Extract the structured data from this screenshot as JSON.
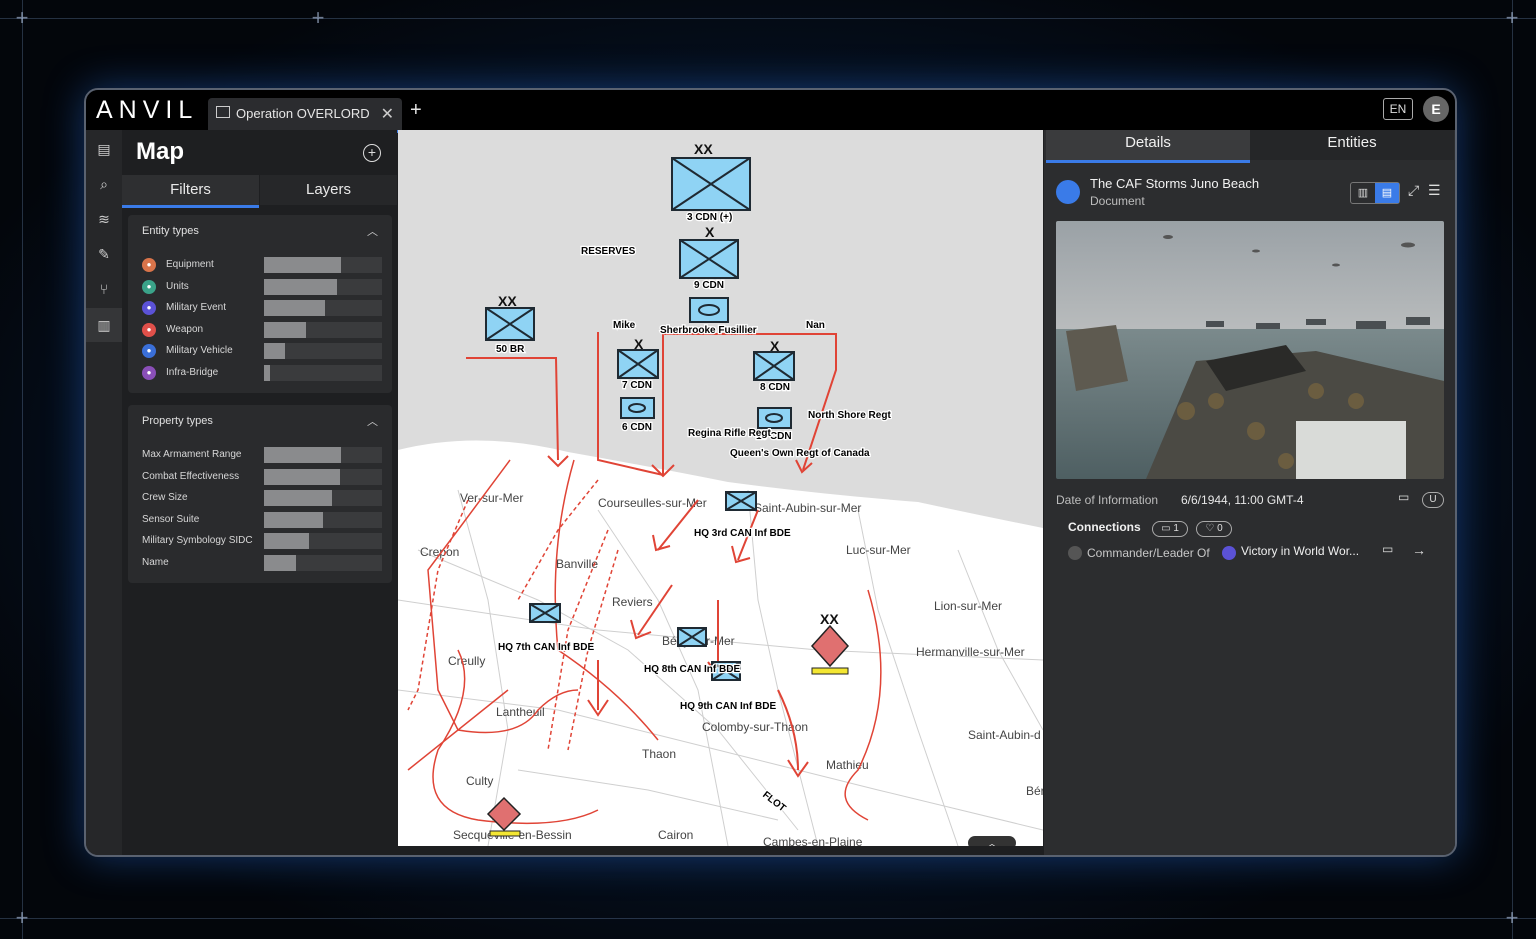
{
  "app": {
    "logo": "ANVIL",
    "tab_label": "Operation OVERLORD",
    "new_tab": "+",
    "language": "EN",
    "avatar_initial": "E"
  },
  "left_panel": {
    "title": "Map",
    "tabs": [
      {
        "label": "Filters",
        "active": true
      },
      {
        "label": "Layers",
        "active": false
      }
    ],
    "entity_types": {
      "title": "Entity types",
      "items": [
        {
          "label": "Equipment",
          "color": "#d9744a",
          "fill": 0.65
        },
        {
          "label": "Units",
          "color": "#3aa389",
          "fill": 0.62
        },
        {
          "label": "Military Event",
          "color": "#5b52d6",
          "fill": 0.52
        },
        {
          "label": "Weapon",
          "color": "#e0504a",
          "fill": 0.36
        },
        {
          "label": "Military Vehicle",
          "color": "#3a6fd8",
          "fill": 0.18
        },
        {
          "label": "Infra-Bridge",
          "color": "#8a4fb8",
          "fill": 0.05
        }
      ]
    },
    "property_types": {
      "title": "Property types",
      "items": [
        {
          "label": "Max Armament Range",
          "fill": 0.65
        },
        {
          "label": "Combat Effectiveness",
          "fill": 0.64
        },
        {
          "label": "Crew Size",
          "fill": 0.58
        },
        {
          "label": "Sensor Suite",
          "fill": 0.5
        },
        {
          "label": "Military Symbology SIDC",
          "fill": 0.38
        },
        {
          "label": "Name",
          "fill": 0.27
        }
      ]
    }
  },
  "map": {
    "places": [
      "Ver-sur-Mer",
      "Courseulles-sur-Mer",
      "Saint-Aubin-sur-Mer",
      "Luc-sur-Mer",
      "Crepon",
      "Banville",
      "Reviers",
      "Lion-sur-Mer",
      "Hermanville-sur-Mer",
      "Creully",
      "Bény-sur-Mer",
      "Lantheuil",
      "Colomby-sur-Thaon",
      "Thaon",
      "Mathieu",
      "Saint-Aubin-d",
      "Culty",
      "Secqueville-en-Bessin",
      "Cairon",
      "Cambes-en-Plaine",
      "Bér"
    ],
    "units": [
      "3 CDN (+)",
      "RESERVES",
      "9 CDN",
      "50 BR",
      "Sherbrooke Fusillier",
      "Mike",
      "Nan",
      "7 CDN",
      "8 CDN",
      "6 CDN",
      "10 CDN",
      "Regina Rifle Regt",
      "North Shore Regt",
      "Queen's Own Regt of Canada",
      "HQ 3rd CAN Inf BDE",
      "HQ 7th CAN Inf BDE",
      "HQ 8th CAN Inf BDE",
      "HQ 9th CAN Inf BDE",
      "FLOT"
    ]
  },
  "right_panel": {
    "tabs": [
      {
        "label": "Details",
        "active": true
      },
      {
        "label": "Entities",
        "active": false
      }
    ],
    "title": "The CAF Storms Juno Beach",
    "subtitle": "Document",
    "date_label": "Date of Information",
    "date_value": "6/6/1944, 11:00 GMT-4",
    "badge": "U",
    "connections_label": "Connections",
    "conn_count_1": "1",
    "conn_count_2": "0",
    "relation": "Commander/Leader Of",
    "target": "Victory in World Wor..."
  }
}
